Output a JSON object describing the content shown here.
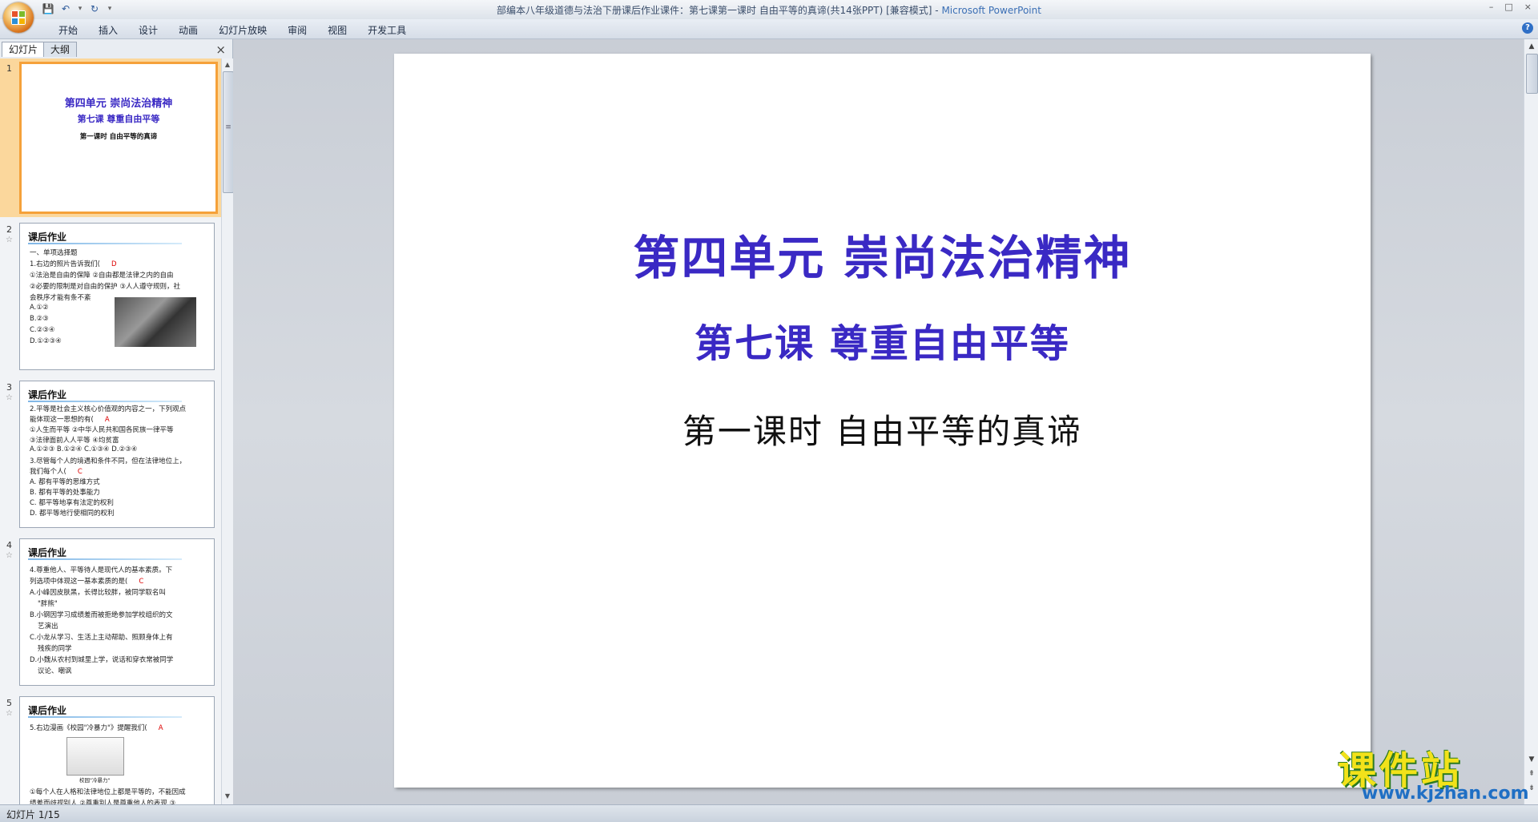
{
  "window": {
    "title": "部编本八年级道德与法治下册课后作业课件：第七课第一课时 自由平等的真谛(共14张PPT) [兼容模式] - ",
    "app_name": "Microsoft PowerPoint",
    "controls": {
      "minimize": "–",
      "maximize": "□",
      "close": "×"
    }
  },
  "quick_access": {
    "save": "💾",
    "undo": "↶",
    "undo_dropdown": "▾",
    "redo": "↻",
    "customize": "▾"
  },
  "ribbon": {
    "tabs": [
      "开始",
      "插入",
      "设计",
      "动画",
      "幻灯片放映",
      "审阅",
      "视图",
      "开发工具"
    ],
    "help": "?"
  },
  "left_panel": {
    "tabs": {
      "slides": "幻灯片",
      "outline": "大纲"
    },
    "close": "×",
    "scroll": {
      "up": "▲",
      "down": "▼",
      "grip": "≡"
    },
    "thumbnails": [
      {
        "num": "1",
        "lines": [
          "第四单元  崇尚法治精神",
          "第七课  尊重自由平等",
          "第一课时  自由平等的真谛"
        ]
      },
      {
        "num": "2",
        "star": "☆",
        "title": "课后作业",
        "lines": [
          "一、单项选择题",
          "1.右边的照片告诉我们(",
          "①法治是自由的保障  ②自由都是法律之内的自由",
          "②必要的限制是对自由的保护  ③人人遵守规则，社",
          "会秩序才能有条不紊",
          "A.①②",
          "B.②③",
          "C.②③④",
          "D.①②③④"
        ],
        "answer": "D"
      },
      {
        "num": "3",
        "star": "☆",
        "title": "课后作业",
        "lines": [
          "2.平等是社会主义核心价值观的内容之一，下列观点",
          "能体现这一思想的有(",
          "①人生而平等  ②中华人民共和国各民族一律平等",
          "③法律面前人人平等  ④均贫富",
          "A.①②③   B.①②④   C.①③④   D.②③④",
          "3.尽管每个人的境遇和条件不同，但在法律地位上，",
          "我们每个人(",
          "A. 都有平等的思维方式",
          "B. 都有平等的处事能力",
          "C. 都平等地享有法定的权利",
          "D. 都平等地行使相同的权利"
        ],
        "answers": [
          "A",
          "C"
        ]
      },
      {
        "num": "4",
        "star": "☆",
        "title": "课后作业",
        "lines": [
          "4.尊重他人、平等待人是现代人的基本素质。下",
          "列选项中体现这一基本素质的是(",
          "A.小峰因皮肤黑，长得比较胖，被同学取名叫",
          "\"胖熊\"",
          "B.小钢因学习成绩差而被拒绝参加学校组织的文",
          "艺演出",
          "C.小龙从学习、生活上主动帮助、照顾身体上有",
          "残疾的同学",
          "D.小魏从农村到城里上学，说话和穿衣常被同学",
          "议论、嘲讽"
        ],
        "answer": "C"
      },
      {
        "num": "5",
        "star": "☆",
        "title": "课后作业",
        "lines": [
          "5.右边漫画《校园\"冷暴力\"》提醒我们(",
          "校园\"冷暴力\"",
          "①每个人在人格和法律地位上都是平等的，不能因成",
          "绩差而歧视别人  ②尊重别人是尊重他人的表现  ③"
        ],
        "answer": "A"
      }
    ]
  },
  "slide": {
    "title": "第四单元   崇尚法治精神",
    "subtitle": "第七课  尊重自由平等",
    "subsubtitle": "第一课时  自由平等的真谛"
  },
  "right_scroll": {
    "up": "▲",
    "down": "▼",
    "prev": "⇞",
    "next": "⇟"
  },
  "status": {
    "text": "幻灯片 1/15"
  },
  "watermark": {
    "title": "课件站",
    "url": "www.kjzhan.com"
  },
  "colors": {
    "slide_title": "#3a29c4",
    "selected_thumb": "#f5a13a",
    "answer": "#dd0000"
  }
}
